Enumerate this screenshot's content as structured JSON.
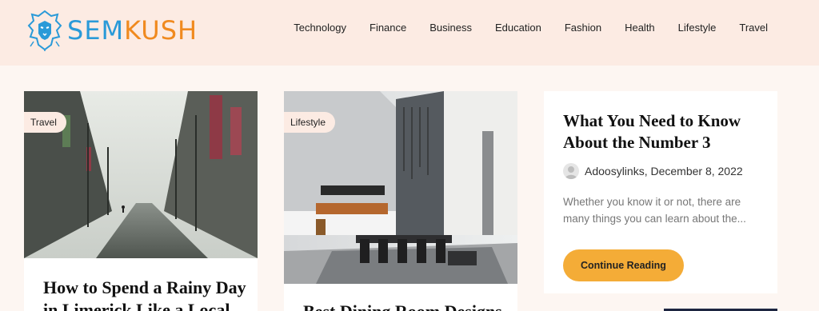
{
  "brand": {
    "name_part1": "SEM",
    "name_part2": "KUSH",
    "logo_icon": "lion-head-icon",
    "colors": {
      "blue": "#2a9ad8",
      "orange": "#f08a1f"
    }
  },
  "nav": {
    "items": [
      "Technology",
      "Finance",
      "Business",
      "Education",
      "Fashion",
      "Health",
      "Lifestyle",
      "Travel"
    ]
  },
  "posts": [
    {
      "category": "Travel",
      "title": "How to Spend a Rainy Day in Limerick Like a Local",
      "image": "rainy-street-image"
    },
    {
      "category": "Lifestyle",
      "title": "Best Dining Room Designs",
      "image": "modern-interior-image"
    },
    {
      "title": "What You Need to Know About the Number 3",
      "author": "Adoosylinks",
      "date": "December 8, 2022",
      "excerpt": "Whether you know it or not, there are many things you can learn about the...",
      "button": "Continue Reading"
    }
  ],
  "colors": {
    "header_bg": "#fcebe3",
    "page_bg": "#fdf6f2",
    "button_bg": "#f4ac37"
  }
}
